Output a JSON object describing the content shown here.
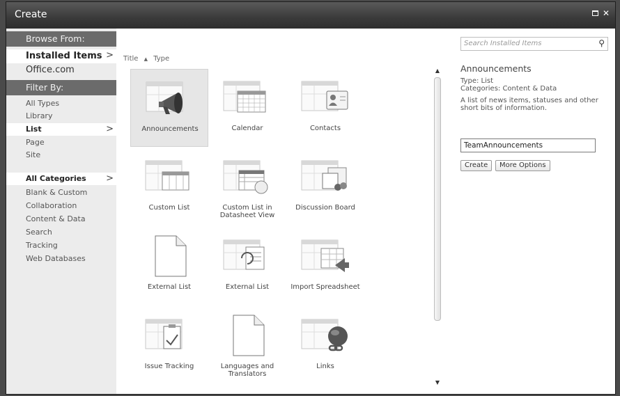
{
  "window": {
    "title": "Create"
  },
  "leftnav": {
    "browse_heading": "Browse From:",
    "browse_items": [
      {
        "label": "Installed Items",
        "selected": true,
        "chevron": ">"
      },
      {
        "label": "Office.com",
        "selected": false
      }
    ],
    "filter_heading": "Filter By:",
    "filter_items": [
      {
        "label": "All Types"
      },
      {
        "label": "Library"
      },
      {
        "label": "List",
        "selected": true,
        "chevron": ">"
      },
      {
        "label": "Page"
      },
      {
        "label": "Site"
      }
    ],
    "category_items": [
      {
        "label": "All Categories",
        "selected": true,
        "chevron": ">"
      },
      {
        "label": "Blank & Custom"
      },
      {
        "label": "Collaboration"
      },
      {
        "label": "Content & Data"
      },
      {
        "label": "Search"
      },
      {
        "label": "Tracking"
      },
      {
        "label": "Web Databases"
      }
    ]
  },
  "sort": {
    "title": "Title",
    "arrow": "▲",
    "type": "Type"
  },
  "tiles": [
    {
      "label": "Announcements",
      "icon": "megaphone-icon",
      "selected": true
    },
    {
      "label": "Calendar",
      "icon": "calendar-icon"
    },
    {
      "label": "Contacts",
      "icon": "contact-card-icon"
    },
    {
      "label": "Custom List",
      "icon": "custom-list-icon"
    },
    {
      "label": "Custom List in Datasheet View",
      "icon": "datasheet-icon"
    },
    {
      "label": "Discussion Board",
      "icon": "discussion-board-icon"
    },
    {
      "label": "External List",
      "icon": "blank-document-icon"
    },
    {
      "label": "External List",
      "icon": "external-list-icon"
    },
    {
      "label": "Import Spreadsheet",
      "icon": "import-spreadsheet-icon"
    },
    {
      "label": "Issue Tracking",
      "icon": "issue-tracking-icon"
    },
    {
      "label": "Languages and Translators",
      "icon": "blank-document-icon"
    },
    {
      "label": "Links",
      "icon": "links-globe-icon"
    }
  ],
  "details": {
    "search_placeholder": "Search Installed Items",
    "title": "Announcements",
    "type": "Type: List",
    "categories": "Categories: Content & Data",
    "description": "A list of news items, statuses and other short bits of information.",
    "name_value": "TeamAnnouncements",
    "create_label": "Create",
    "more_options_label": "More Options"
  }
}
